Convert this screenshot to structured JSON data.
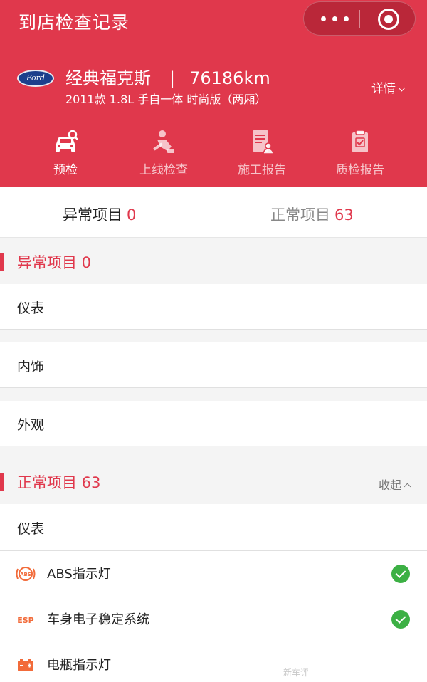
{
  "nav": {
    "title": "到店检查记录"
  },
  "car": {
    "name": "经典福克斯",
    "separator": "|",
    "mileage": "76186km",
    "subtitle": "2011款 1.8L 手自一体 时尚版（两厢）",
    "details_label": "详情",
    "brand_logo_text": "Ford"
  },
  "tabs": [
    {
      "label": "预检",
      "icon": "car-inspect-icon",
      "active": true
    },
    {
      "label": "上线检查",
      "icon": "mechanic-icon",
      "active": false
    },
    {
      "label": "施工报告",
      "icon": "report-person-icon",
      "active": false
    },
    {
      "label": "质检报告",
      "icon": "clipboard-check-icon",
      "active": false
    }
  ],
  "summary": {
    "abnormal_label": "异常项目",
    "abnormal_count": "0",
    "normal_label": "正常项目",
    "normal_count": "63"
  },
  "abnormal_section": {
    "title": "异常项目 0",
    "groups": [
      "仪表",
      "内饰",
      "外观"
    ]
  },
  "normal_section": {
    "title": "正常项目 63",
    "toggle_label": "收起",
    "group": "仪表",
    "items": [
      {
        "label": "ABS指示灯",
        "icon": "abs-warning-icon",
        "icon_text": "ABS",
        "status": "ok"
      },
      {
        "label": "车身电子稳定系统",
        "icon": "esp-icon",
        "icon_text": "ESP",
        "status": "ok"
      },
      {
        "label": "电瓶指示灯",
        "icon": "battery-icon",
        "icon_text": "",
        "status": ""
      }
    ]
  },
  "watermark": "新车评",
  "colors": {
    "brand": "#e0384c",
    "ok": "#3cb044",
    "icon_orange": "#f26b3a"
  }
}
